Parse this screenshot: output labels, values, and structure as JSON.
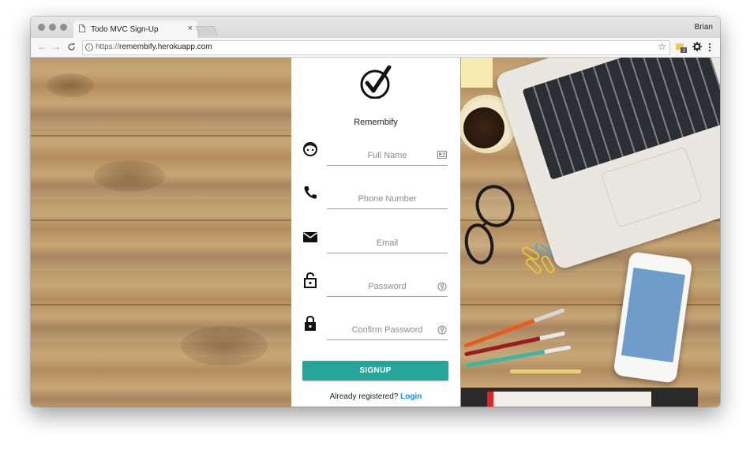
{
  "browser": {
    "tab_title": "Todo MVC Sign-Up",
    "tab_close": "×",
    "profile_name": "Brian",
    "url_scheme": "https://",
    "url_host": "remembify.herokuapp.com",
    "extension_badge": "2"
  },
  "page": {
    "brand": "Remembify",
    "fields": [
      {
        "placeholder": "Full Name",
        "icon": "face-icon",
        "suffix_icon": "id-card-icon"
      },
      {
        "placeholder": "Phone Number",
        "icon": "phone-icon",
        "suffix_icon": ""
      },
      {
        "placeholder": "Email",
        "icon": "envelope-icon",
        "suffix_icon": ""
      },
      {
        "placeholder": "Password",
        "icon": "lock-open-icon",
        "suffix_icon": "key-icon"
      },
      {
        "placeholder": "Confirm Password",
        "icon": "lock-icon",
        "suffix_icon": "key-icon"
      }
    ],
    "signup_label": "SIGNUP",
    "already_text": "Already registered?",
    "login_label": "Login"
  },
  "colors": {
    "accent": "#26a69a",
    "link": "#1e88e5"
  }
}
